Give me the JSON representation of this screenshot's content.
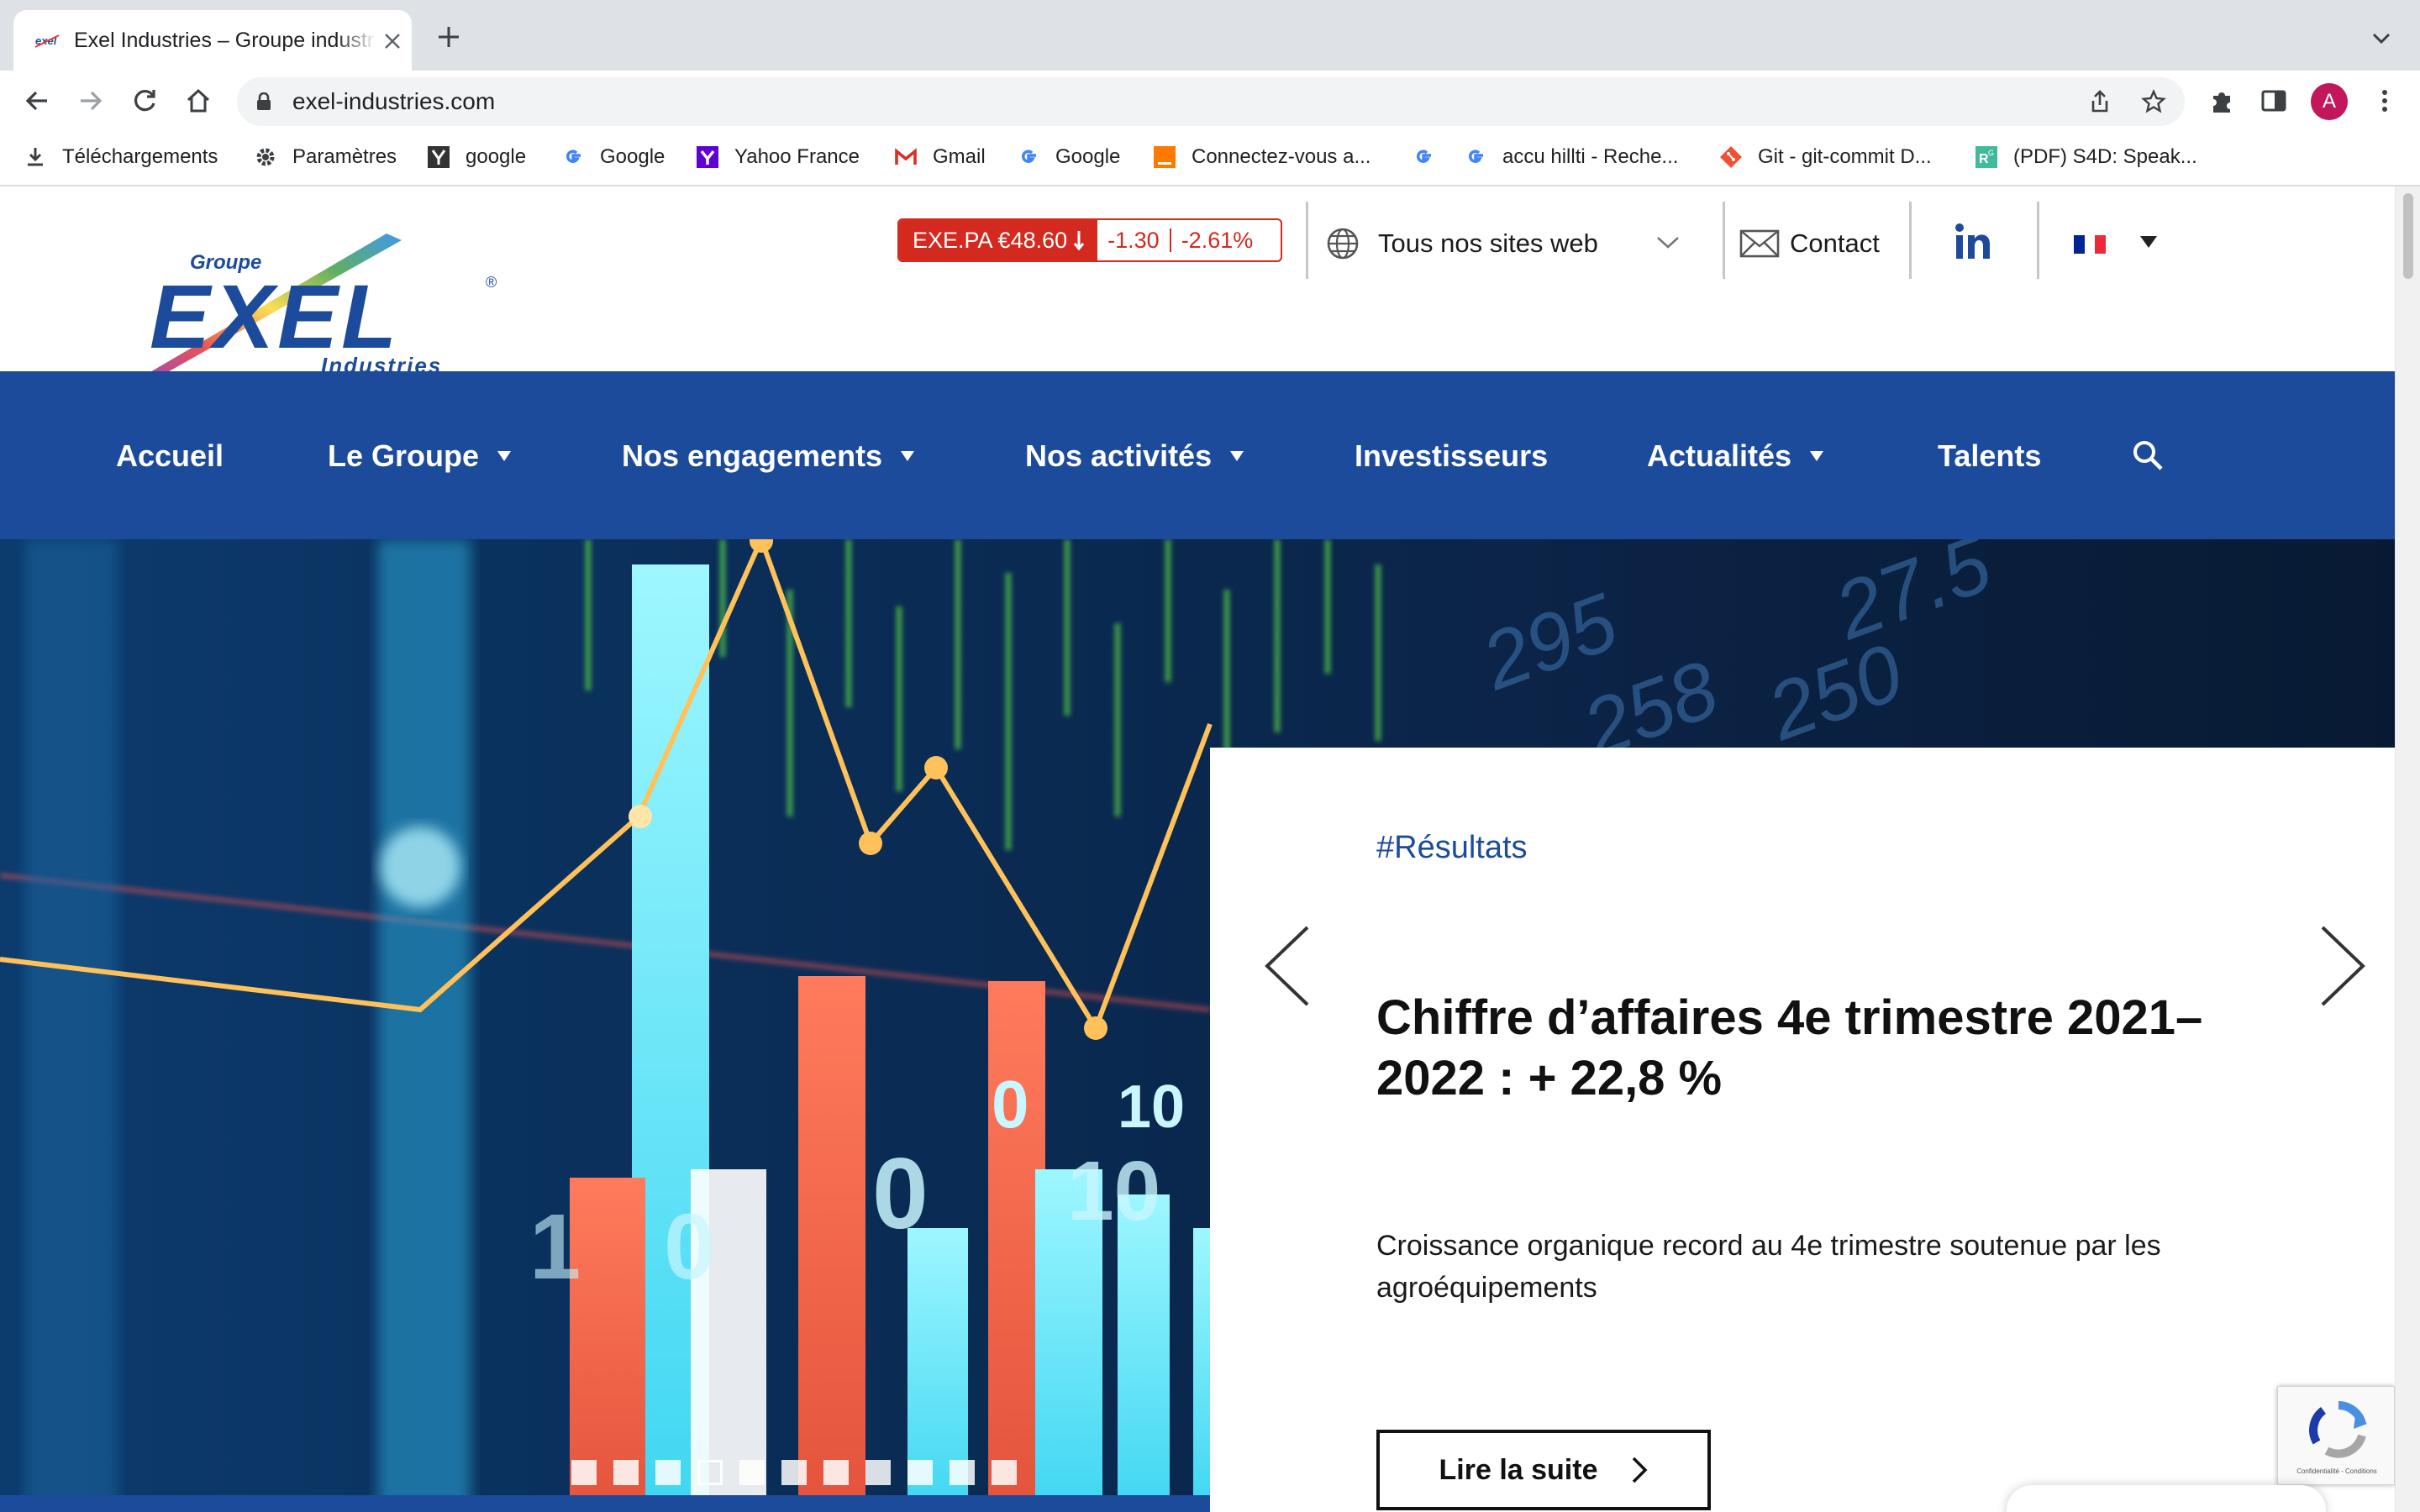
{
  "browser": {
    "tab": {
      "title": "Exel Industries – Groupe industriel",
      "favicon": "exel-favicon"
    },
    "url": "exel-industries.com",
    "avatar_initial": "A",
    "bookmarks": [
      {
        "label": "Téléchargements",
        "icon": "download-icon"
      },
      {
        "label": "Paramètres",
        "icon": "gear-icon"
      },
      {
        "label": "google",
        "icon": "google-box-icon"
      },
      {
        "label": "Google",
        "icon": "google-icon"
      },
      {
        "label": "Yahoo France",
        "icon": "yahoo-icon"
      },
      {
        "label": "Gmail",
        "icon": "gmail-icon"
      },
      {
        "label": "Google",
        "icon": "google-icon"
      },
      {
        "label": "Connectez-vous a...",
        "icon": "orange-icon"
      },
      {
        "label": "",
        "icon": "google-icon"
      },
      {
        "label": "accu hillti - Reche...",
        "icon": "google-icon"
      },
      {
        "label": "Git - git-commit D...",
        "icon": "git-icon"
      },
      {
        "label": "(PDF) S4D: Speak...",
        "icon": "researchgate-icon"
      }
    ]
  },
  "header": {
    "ticker": {
      "symbol_price": "EXE.PA €48.60",
      "change": "-1.30",
      "change_pct": "-2.61%"
    },
    "sites_label": "Tous nos sites web",
    "contact_label": "Contact",
    "linkedin_label": "in",
    "language": "FR"
  },
  "nav": {
    "items": [
      {
        "label": "Accueil"
      },
      {
        "label": "Le Groupe"
      },
      {
        "label": "Nos engagements"
      },
      {
        "label": "Nos activités"
      },
      {
        "label": "Investisseurs"
      },
      {
        "label": "Actualités"
      },
      {
        "label": "Talents"
      }
    ]
  },
  "hero": {
    "tag": "#Résultats",
    "title": "Chiffre d’affaires 4e trimestre 2021–2022 : + 22,8 %",
    "text": "Croissance organique record au 4e trimestre soutenue par les agroéquipements",
    "button_label": "Lire la suite",
    "slide_count": 11,
    "active_slide": 4
  },
  "recaptcha": {
    "footer": "Confidentialité - Conditions"
  },
  "colors": {
    "brand_blue": "#1d4b9b",
    "ticker_red": "#d4291f",
    "chrome_gray": "#dee1e6"
  }
}
